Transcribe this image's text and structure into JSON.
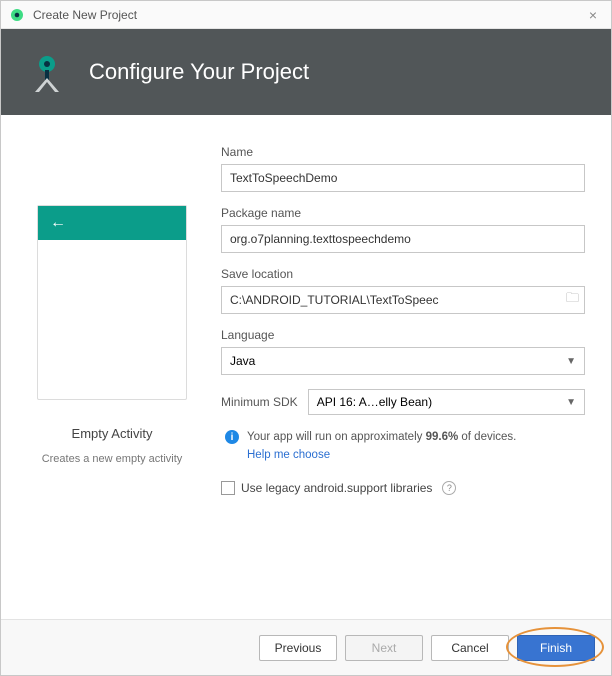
{
  "window": {
    "title": "Create New Project"
  },
  "header": {
    "title": "Configure Your Project"
  },
  "template": {
    "title": "Empty Activity",
    "description": "Creates a new empty activity"
  },
  "form": {
    "name": {
      "label": "Name",
      "value": "TextToSpeechDemo"
    },
    "package": {
      "label": "Package name",
      "value": "org.o7planning.texttospeechdemo"
    },
    "save": {
      "label": "Save location",
      "value": "C:\\ANDROID_TUTORIAL\\TextToSpeec"
    },
    "language": {
      "label": "Language",
      "value": "Java"
    },
    "minsdk": {
      "label": "Minimum SDK",
      "value": "API 16: A…elly Bean)"
    },
    "info": {
      "line1a": "Your app will run on approximately",
      "pct": "99.6%",
      "line1b": " of devices.",
      "link": "Help me choose"
    },
    "legacy": {
      "label": "Use legacy android.support libraries"
    }
  },
  "buttons": {
    "previous": "Previous",
    "next": "Next",
    "cancel": "Cancel",
    "finish": "Finish"
  }
}
